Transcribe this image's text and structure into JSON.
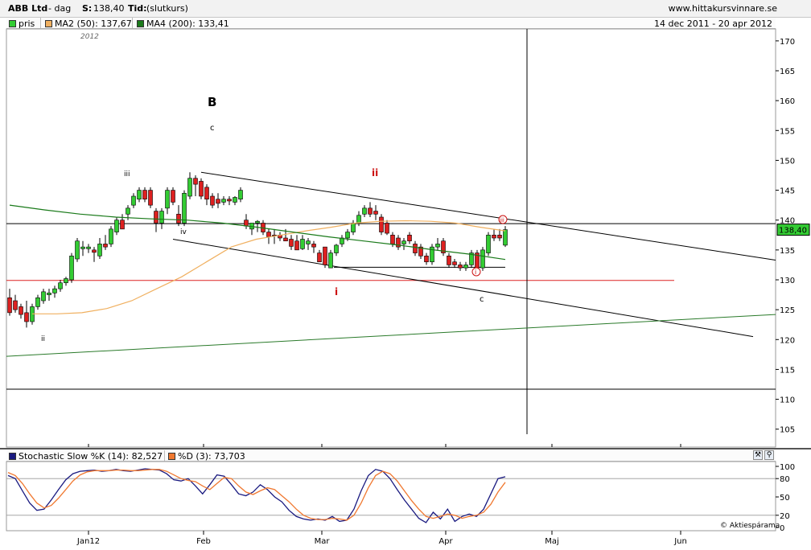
{
  "header": {
    "title": "ABB Ltd",
    "period": "- dag",
    "s_label": "S:",
    "s_value": "138,40",
    "tid_label": "Tid:",
    "tid_value": "(slutkurs)",
    "site": "www.hittakursvinnare.se"
  },
  "legend": {
    "items": [
      {
        "label": "pris",
        "color": "#33cc33"
      },
      {
        "label": "MA2 (50): 137,67",
        "color": "#f0b060"
      },
      {
        "label": "MA4 (200): 133,41",
        "color": "#1a7a1a"
      }
    ],
    "date_range": "14 dec 2011 - 20 apr 2012"
  },
  "stoch_legend": {
    "items": [
      {
        "label": "Stochastic Slow %K (14): 82,527",
        "color": "#1a1a80"
      },
      {
        "label": "%D (3): 73,703",
        "color": "#f07830"
      }
    ]
  },
  "credit": "© Aktiespárama",
  "chart_data": [
    {
      "type": "candlestick",
      "title": "ABB Ltd - dag",
      "year_label": "2012",
      "y_ticks": [
        105,
        110,
        115,
        120,
        125,
        130,
        135,
        140,
        145,
        150,
        155,
        160,
        165,
        170
      ],
      "ylim": [
        102,
        172
      ],
      "x_ticks": [
        "Jan12",
        "Feb",
        "Mar",
        "Apr",
        "Maj",
        "Jun"
      ],
      "last_price_label": "138,40",
      "ohlc": [
        {
          "o": 127.0,
          "h": 128.5,
          "l": 124.0,
          "c": 124.5,
          "up": false
        },
        {
          "o": 126.5,
          "h": 127.5,
          "l": 124.5,
          "c": 125.0,
          "up": false
        },
        {
          "o": 125.5,
          "h": 126.0,
          "l": 123.5,
          "c": 124.2,
          "up": false
        },
        {
          "o": 124.5,
          "h": 126.5,
          "l": 122.0,
          "c": 123.0,
          "up": false
        },
        {
          "o": 123.0,
          "h": 126.0,
          "l": 122.5,
          "c": 125.5,
          "up": true
        },
        {
          "o": 125.5,
          "h": 127.5,
          "l": 125.0,
          "c": 127.0,
          "up": true
        },
        {
          "o": 126.5,
          "h": 128.5,
          "l": 126.0,
          "c": 128.0,
          "up": true
        },
        {
          "o": 127.5,
          "h": 128.5,
          "l": 126.5,
          "c": 127.8,
          "up": true
        },
        {
          "o": 127.8,
          "h": 129.0,
          "l": 127.0,
          "c": 128.5,
          "up": true
        },
        {
          "o": 128.5,
          "h": 130.0,
          "l": 128.0,
          "c": 129.5,
          "up": true
        },
        {
          "o": 129.5,
          "h": 130.5,
          "l": 129.0,
          "c": 130.2,
          "up": true
        },
        {
          "o": 130.0,
          "h": 134.5,
          "l": 129.5,
          "c": 134.0,
          "up": true
        },
        {
          "o": 133.5,
          "h": 137.0,
          "l": 133.0,
          "c": 136.5,
          "up": true
        },
        {
          "o": 135.5,
          "h": 136.5,
          "l": 134.0,
          "c": 135.2,
          "up": true
        },
        {
          "o": 135.2,
          "h": 136.0,
          "l": 134.5,
          "c": 135.5,
          "up": true
        },
        {
          "o": 135.0,
          "h": 135.5,
          "l": 133.0,
          "c": 134.6,
          "up": false
        },
        {
          "o": 134.0,
          "h": 137.0,
          "l": 133.5,
          "c": 136.0,
          "up": true
        },
        {
          "o": 135.5,
          "h": 137.5,
          "l": 135.0,
          "c": 136.0,
          "up": false
        },
        {
          "o": 136.0,
          "h": 139.0,
          "l": 135.5,
          "c": 138.5,
          "up": true
        },
        {
          "o": 138.0,
          "h": 140.5,
          "l": 137.5,
          "c": 140.0,
          "up": true
        },
        {
          "o": 140.0,
          "h": 141.0,
          "l": 138.5,
          "c": 138.5,
          "up": false
        },
        {
          "o": 141.0,
          "h": 142.5,
          "l": 140.0,
          "c": 142.0,
          "up": true
        },
        {
          "o": 142.5,
          "h": 144.5,
          "l": 142.0,
          "c": 144.0,
          "up": true
        },
        {
          "o": 143.5,
          "h": 145.5,
          "l": 143.0,
          "c": 145.0,
          "up": true
        },
        {
          "o": 145.0,
          "h": 145.5,
          "l": 143.0,
          "c": 143.5,
          "up": false
        },
        {
          "o": 145.0,
          "h": 145.5,
          "l": 142.0,
          "c": 142.5,
          "up": false
        },
        {
          "o": 141.5,
          "h": 142.0,
          "l": 138.0,
          "c": 139.5,
          "up": false
        },
        {
          "o": 139.5,
          "h": 142.0,
          "l": 138.5,
          "c": 141.5,
          "up": true
        },
        {
          "o": 142.0,
          "h": 145.5,
          "l": 141.0,
          "c": 145.0,
          "up": true
        },
        {
          "o": 145.0,
          "h": 145.5,
          "l": 142.5,
          "c": 143.0,
          "up": false
        },
        {
          "o": 141.0,
          "h": 142.5,
          "l": 139.0,
          "c": 139.5,
          "up": false
        },
        {
          "o": 139.5,
          "h": 145.0,
          "l": 139.0,
          "c": 144.5,
          "up": true
        },
        {
          "o": 144.0,
          "h": 148.0,
          "l": 143.5,
          "c": 147.0,
          "up": true
        },
        {
          "o": 147.0,
          "h": 147.5,
          "l": 144.0,
          "c": 146.0,
          "up": false
        },
        {
          "o": 146.5,
          "h": 147.0,
          "l": 143.5,
          "c": 144.0,
          "up": false
        },
        {
          "o": 145.5,
          "h": 146.0,
          "l": 142.5,
          "c": 143.5,
          "up": false
        },
        {
          "o": 144.0,
          "h": 144.5,
          "l": 142.0,
          "c": 142.5,
          "up": false
        },
        {
          "o": 143.5,
          "h": 144.5,
          "l": 142.0,
          "c": 142.8,
          "up": false
        },
        {
          "o": 143.0,
          "h": 144.0,
          "l": 142.5,
          "c": 143.5,
          "up": true
        },
        {
          "o": 143.5,
          "h": 144.0,
          "l": 142.5,
          "c": 143.2,
          "up": false
        },
        {
          "o": 143.0,
          "h": 144.0,
          "l": 142.5,
          "c": 143.8,
          "up": true
        },
        {
          "o": 143.5,
          "h": 145.5,
          "l": 143.0,
          "c": 145.0,
          "up": true
        },
        {
          "o": 140.0,
          "h": 141.0,
          "l": 138.5,
          "c": 139.0,
          "up": false
        },
        {
          "o": 138.5,
          "h": 139.5,
          "l": 137.5,
          "c": 139.5,
          "up": true
        },
        {
          "o": 139.5,
          "h": 140.0,
          "l": 138.0,
          "c": 139.8,
          "up": true
        },
        {
          "o": 139.5,
          "h": 140.0,
          "l": 137.5,
          "c": 138.0,
          "up": false
        },
        {
          "o": 138.0,
          "h": 138.5,
          "l": 136.0,
          "c": 137.2,
          "up": false
        },
        {
          "o": 137.5,
          "h": 138.5,
          "l": 136.0,
          "c": 137.5,
          "up": false
        },
        {
          "o": 137.5,
          "h": 138.0,
          "l": 136.5,
          "c": 137.0,
          "up": false
        },
        {
          "o": 137.0,
          "h": 138.5,
          "l": 136.5,
          "c": 136.5,
          "up": false
        },
        {
          "o": 136.8,
          "h": 137.5,
          "l": 135.0,
          "c": 135.6,
          "up": false
        },
        {
          "o": 136.5,
          "h": 137.5,
          "l": 135.0,
          "c": 135.0,
          "up": false
        },
        {
          "o": 135.2,
          "h": 137.5,
          "l": 135.0,
          "c": 136.8,
          "up": true
        },
        {
          "o": 136.0,
          "h": 137.0,
          "l": 135.0,
          "c": 136.5,
          "up": true
        },
        {
          "o": 136.0,
          "h": 136.5,
          "l": 134.5,
          "c": 135.5,
          "up": false
        },
        {
          "o": 134.5,
          "h": 135.0,
          "l": 133.0,
          "c": 133.0,
          "up": false
        },
        {
          "o": 135.5,
          "h": 135.5,
          "l": 132.0,
          "c": 132.5,
          "up": false
        },
        {
          "o": 132.0,
          "h": 135.0,
          "l": 132.0,
          "c": 134.5,
          "up": true
        },
        {
          "o": 134.5,
          "h": 136.0,
          "l": 134.0,
          "c": 135.8,
          "up": true
        },
        {
          "o": 136.0,
          "h": 137.5,
          "l": 135.5,
          "c": 137.0,
          "up": true
        },
        {
          "o": 137.0,
          "h": 138.5,
          "l": 136.5,
          "c": 138.0,
          "up": true
        },
        {
          "o": 138.0,
          "h": 140.0,
          "l": 137.5,
          "c": 139.5,
          "up": true
        },
        {
          "o": 139.5,
          "h": 141.5,
          "l": 139.0,
          "c": 140.8,
          "up": true
        },
        {
          "o": 141.0,
          "h": 142.5,
          "l": 140.5,
          "c": 142.0,
          "up": true
        },
        {
          "o": 142.0,
          "h": 143.0,
          "l": 140.5,
          "c": 141.0,
          "up": false
        },
        {
          "o": 141.5,
          "h": 142.5,
          "l": 140.0,
          "c": 141.0,
          "up": false
        },
        {
          "o": 140.5,
          "h": 141.0,
          "l": 137.5,
          "c": 138.0,
          "up": false
        },
        {
          "o": 139.5,
          "h": 140.0,
          "l": 137.5,
          "c": 137.8,
          "up": false
        },
        {
          "o": 137.5,
          "h": 138.0,
          "l": 135.5,
          "c": 136.0,
          "up": false
        },
        {
          "o": 137.0,
          "h": 137.5,
          "l": 135.0,
          "c": 135.5,
          "up": false
        },
        {
          "o": 136.0,
          "h": 137.0,
          "l": 135.0,
          "c": 136.5,
          "up": true
        },
        {
          "o": 137.5,
          "h": 138.0,
          "l": 136.0,
          "c": 136.5,
          "up": false
        },
        {
          "o": 136.0,
          "h": 136.5,
          "l": 134.0,
          "c": 134.5,
          "up": false
        },
        {
          "o": 135.5,
          "h": 136.0,
          "l": 133.5,
          "c": 134.0,
          "up": false
        },
        {
          "o": 134.0,
          "h": 134.5,
          "l": 132.5,
          "c": 133.0,
          "up": false
        },
        {
          "o": 133.0,
          "h": 136.0,
          "l": 132.5,
          "c": 135.5,
          "up": true
        },
        {
          "o": 135.5,
          "h": 137.0,
          "l": 135.0,
          "c": 136.0,
          "up": true
        },
        {
          "o": 136.5,
          "h": 137.0,
          "l": 134.0,
          "c": 134.5,
          "up": false
        },
        {
          "o": 134.0,
          "h": 134.5,
          "l": 132.0,
          "c": 132.5,
          "up": false
        },
        {
          "o": 133.0,
          "h": 133.5,
          "l": 132.0,
          "c": 132.5,
          "up": false
        },
        {
          "o": 132.5,
          "h": 133.0,
          "l": 131.5,
          "c": 132.0,
          "up": false
        },
        {
          "o": 132.0,
          "h": 133.0,
          "l": 131.5,
          "c": 132.5,
          "up": true
        },
        {
          "o": 132.5,
          "h": 135.0,
          "l": 132.0,
          "c": 134.5,
          "up": true
        },
        {
          "o": 134.5,
          "h": 135.0,
          "l": 131.5,
          "c": 132.0,
          "up": false
        },
        {
          "o": 132.0,
          "h": 135.5,
          "l": 131.5,
          "c": 135.0,
          "up": true
        },
        {
          "o": 134.5,
          "h": 138.0,
          "l": 134.0,
          "c": 137.5,
          "up": true
        },
        {
          "o": 137.5,
          "h": 138.5,
          "l": 136.5,
          "c": 137.0,
          "up": false
        },
        {
          "o": 137.5,
          "h": 138.5,
          "l": 136.5,
          "c": 137.0,
          "up": false
        },
        {
          "o": 135.8,
          "h": 139.0,
          "l": 135.5,
          "c": 138.4,
          "up": true
        }
      ],
      "ma50": [
        124.3,
        124.3,
        124.5,
        125.2,
        126.5,
        128.5,
        130.5,
        133.0,
        135.5,
        136.8,
        137.5,
        138.2,
        138.8,
        139.5,
        139.8,
        139.9,
        139.8,
        139.5,
        138.8,
        138.2
      ],
      "ma200": [
        142.5,
        141.7,
        141.0,
        140.5,
        140.2,
        140.0,
        139.5,
        138.8,
        138.0,
        137.2,
        136.5,
        135.8,
        135.0,
        134.3,
        133.4
      ],
      "annotations": {
        "wave_B": "B",
        "c_upper": "c",
        "c_lower": "c",
        "iii": "iii",
        "iv": "iv",
        "ii_black": "ii",
        "ii_red": "ii",
        "i_red": "i",
        "i_circle": "i",
        "iii_circle": "iii"
      },
      "hlines": [
        {
          "y": 139.4,
          "color": "#000000"
        },
        {
          "y": 129.9,
          "color": "#dd2222"
        },
        {
          "y": 111.7,
          "color": "#000000"
        },
        {
          "y": 132.1,
          "color": "#000000"
        }
      ]
    },
    {
      "type": "line",
      "title": "Stochastic Slow",
      "y_ticks": [
        0,
        20,
        50,
        80,
        100
      ],
      "ylim": [
        0,
        100
      ],
      "series": [
        {
          "name": "%K (14)",
          "color": "#1a1a80",
          "values": [
            85,
            80,
            60,
            40,
            28,
            30,
            45,
            62,
            78,
            88,
            92,
            93,
            94,
            92,
            93,
            95,
            93,
            92,
            94,
            96,
            95,
            94,
            88,
            78,
            76,
            80,
            68,
            55,
            70,
            86,
            84,
            70,
            55,
            52,
            58,
            70,
            62,
            50,
            42,
            28,
            18,
            14,
            12,
            14,
            12,
            18,
            10,
            12,
            30,
            60,
            85,
            95,
            92,
            80,
            62,
            45,
            30,
            15,
            8,
            25,
            14,
            30,
            10,
            18,
            22,
            18,
            30,
            55,
            80,
            83
          ]
        },
        {
          "name": "%D (3)",
          "color": "#f07830",
          "values": [
            90,
            85,
            72,
            55,
            40,
            32,
            36,
            48,
            62,
            76,
            86,
            91,
            93,
            93,
            93,
            94,
            94,
            93,
            93,
            94,
            95,
            95,
            92,
            86,
            80,
            77,
            75,
            68,
            62,
            72,
            82,
            80,
            68,
            58,
            54,
            60,
            65,
            62,
            52,
            42,
            30,
            20,
            15,
            13,
            13,
            15,
            14,
            12,
            20,
            40,
            65,
            85,
            92,
            88,
            76,
            60,
            44,
            30,
            18,
            15,
            18,
            22,
            20,
            15,
            18,
            20,
            25,
            38,
            58,
            74
          ]
        }
      ],
      "hlines": [
        20,
        80
      ]
    }
  ]
}
